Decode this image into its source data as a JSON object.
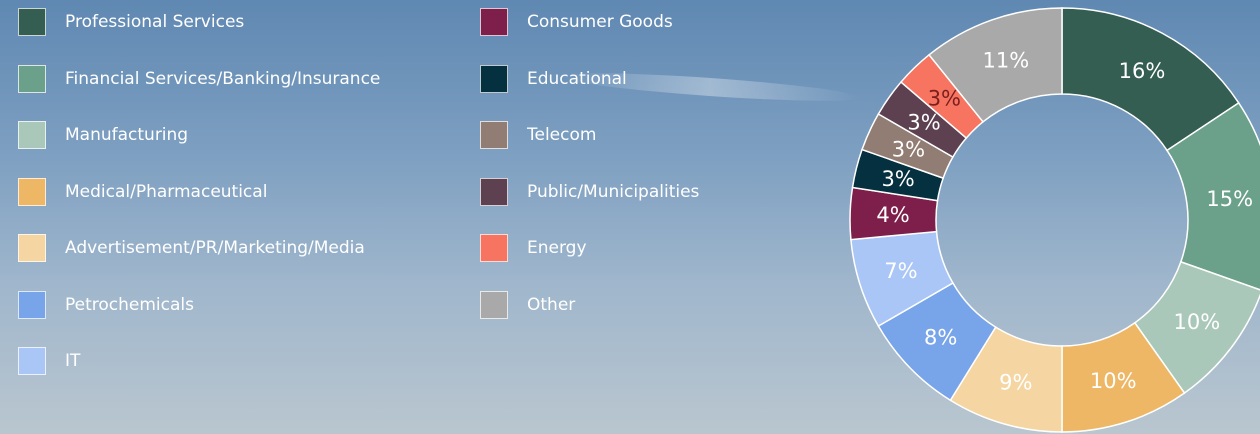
{
  "chart_data": {
    "type": "pie",
    "donut": true,
    "legend_position": "left",
    "slices": [
      {
        "label": "Professional Services",
        "value": 16,
        "display": "16%",
        "color": "#355e52",
        "text_color": "#ffffff"
      },
      {
        "label": "Financial Services/Banking/Insurance",
        "value": 15,
        "display": "15%",
        "color": "#6ba18b",
        "text_color": "#ffffff"
      },
      {
        "label": "Manufacturing",
        "value": 10,
        "display": "10%",
        "color": "#a9c8ba",
        "text_color": "#ffffff"
      },
      {
        "label": "Medical/Pharmaceutical",
        "value": 10,
        "display": "10%",
        "color": "#eeb765",
        "text_color": "#ffffff"
      },
      {
        "label": "Advertisement/PR/Marketing/Media",
        "value": 9,
        "display": "9%",
        "color": "#f5d6a2",
        "text_color": "#ffffff"
      },
      {
        "label": "Petrochemicals",
        "value": 8,
        "display": "8%",
        "color": "#78a4e9",
        "text_color": "#ffffff"
      },
      {
        "label": "IT",
        "value": 7,
        "display": "7%",
        "color": "#aac6f6",
        "text_color": "#ffffff"
      },
      {
        "label": "Consumer Goods",
        "value": 4,
        "display": "4%",
        "color": "#7e1f4b",
        "text_color": "#ffffff"
      },
      {
        "label": "Educational",
        "value": 3,
        "display": "3%",
        "color": "#05303f",
        "text_color": "#ffffff"
      },
      {
        "label": "Telecom",
        "value": 3,
        "display": "3%",
        "color": "#917d73",
        "text_color": "#ffffff"
      },
      {
        "label": "Public/Municipalities",
        "value": 3,
        "display": "3%",
        "color": "#5e4151",
        "text_color": "#ffffff"
      },
      {
        "label": "Energy",
        "value": 3,
        "display": "3%",
        "color": "#f77460",
        "text_color": "#7a1f1f"
      },
      {
        "label": "Other",
        "value": 11,
        "display": "11%",
        "color": "#a9a9a9",
        "text_color": "#ffffff"
      }
    ]
  }
}
